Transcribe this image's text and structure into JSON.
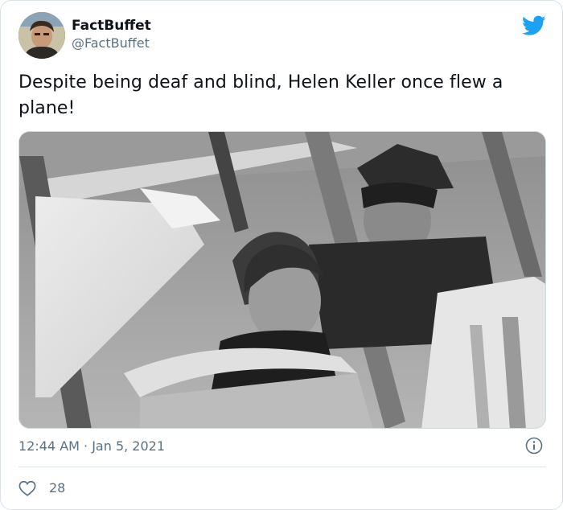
{
  "tweet": {
    "display_name": "FactBuffet",
    "handle": "@FactBuffet",
    "text": "Despite being deaf and blind, Helen Keller once flew a plane!",
    "media": {
      "icon": "photo-image"
    },
    "timestamp": "12:44 AM · Jan 5, 2021",
    "like_count": "28"
  },
  "icons": {
    "brand": "twitter-bird-icon",
    "info": "info-icon",
    "like": "heart-icon"
  },
  "colors": {
    "brand_blue": "#1da1f2",
    "secondary_text": "#5b7083",
    "border": "#d9e1e7"
  }
}
